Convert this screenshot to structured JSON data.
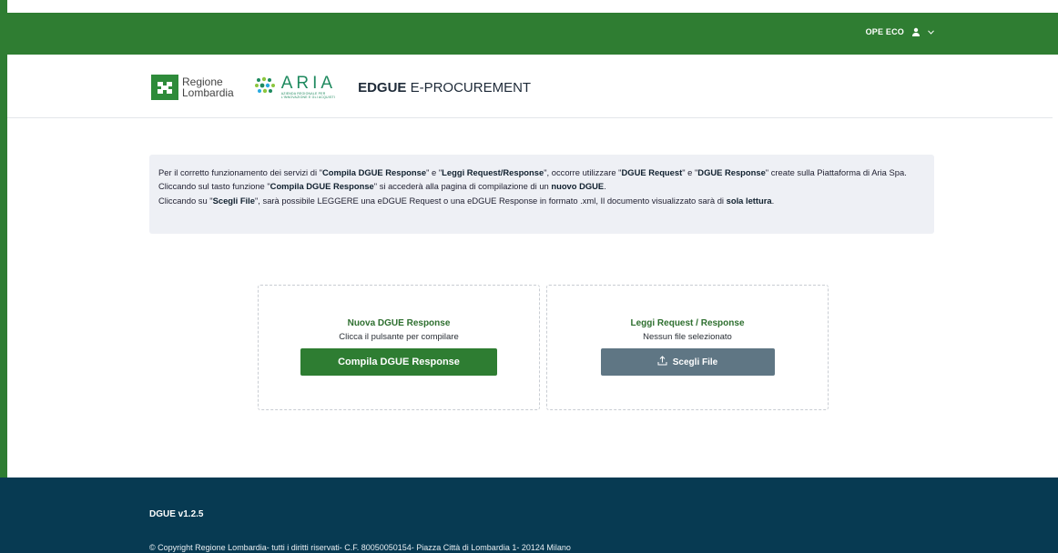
{
  "topbar": {
    "user_name": "OPE ECO",
    "user_icon": "person-icon",
    "menu_icon": "chevron-down-icon",
    "color": "#2f7d32"
  },
  "header": {
    "regione_line1": "Regione",
    "regione_line2": "Lombardia",
    "aria_word": "ARIA",
    "aria_sub_line1": "AZIENDA REGIONALE PER",
    "aria_sub_line2": "L'INNOVAZIONE E GLI ACQUISTI",
    "app_title_bold": "EDGUE",
    "app_title_rest": " E-PROCUREMENT"
  },
  "notice": {
    "l1_a": "Per il corretto funzionamento dei servizi di \"",
    "l1_b": "Compila DGUE Response",
    "l1_c": "\" e \"",
    "l1_d": "Leggi Request/Response",
    "l1_e": "\", occorre utilizzare \"",
    "l1_f": "DGUE Request",
    "l1_g": "\" e \"",
    "l1_h": "DGUE Response",
    "l1_i": "\" create sulla Piattaforma di Aria Spa.",
    "l2_a": "Cliccando sul tasto funzione \"",
    "l2_b": "Compila DGUE Response",
    "l2_c": "\" si accederà alla pagina di compilazione di un ",
    "l2_d": "nuovo DGUE",
    "l2_e": ".",
    "l3_a": "Cliccando su \"",
    "l3_b": "Scegli File",
    "l3_c": "\", sarà possibile LEGGERE una eDGUE Request o una eDGUE Response in formato .xml, Il documento visualizzato sarà di ",
    "l3_d": "sola lettura",
    "l3_e": "."
  },
  "card_new": {
    "title": "Nuova DGUE Response",
    "subtitle": "Clicca il pulsante per compilare",
    "button": "Compila DGUE Response",
    "button_color": "#2e7d32"
  },
  "card_read": {
    "title": "Leggi Request / Response",
    "subtitle": "Nessun file selezionato",
    "button": "Scegli File",
    "button_icon": "upload-icon",
    "button_color": "#5f7684"
  },
  "footer": {
    "version": "DGUE v1.2.5",
    "copyright": "© Copyright Regione Lombardia- tutti i diritti riservati- C.F. 80050050154- Piazza Città di Lombardia 1- 20124 Milano",
    "color": "#073a52"
  }
}
